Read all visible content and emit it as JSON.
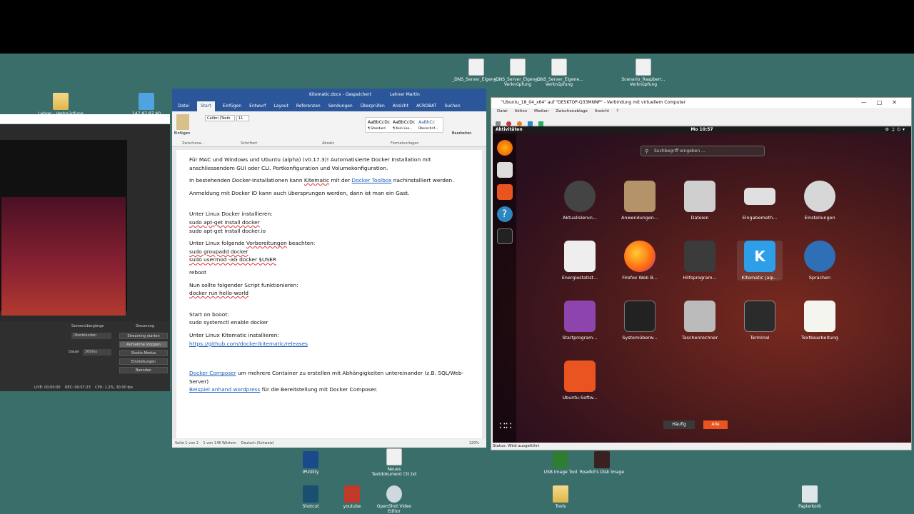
{
  "desktop": {
    "icons": [
      {
        "label": "_DNS_Server_Eigene...",
        "sub": ""
      },
      {
        "label": "_DNS_Server_Eigene...",
        "sub": "Verknüpfung"
      },
      {
        "label": "_DNS_Server_Eigene...",
        "sub": "Verknüpfung"
      },
      {
        "label": "Scenario_Raspberr...",
        "sub": "Verknüpfung"
      },
      {
        "label": "Lehrer - Verknüpfung",
        "sub": ""
      },
      {
        "label": "147.87.87.40",
        "sub": ""
      },
      {
        "label": "IPUtility",
        "sub": ""
      },
      {
        "label": "Neues",
        "sub": "Textdokument (3).txt"
      },
      {
        "label": "USB Image Tool",
        "sub": ""
      },
      {
        "label": "Roadkil's Disk Image",
        "sub": ""
      },
      {
        "label": "Shotcut",
        "sub": ""
      },
      {
        "label": "youtube",
        "sub": ""
      },
      {
        "label": "OpenShot Video",
        "sub": "Editor"
      },
      {
        "label": "Tools",
        "sub": ""
      },
      {
        "label": "Papierkorb",
        "sub": ""
      }
    ]
  },
  "obs": {
    "dock_headers": {
      "transitions": "Szenenübergänge",
      "controls": "Steuerung"
    },
    "transition_value": "Überblenden",
    "duration_label": "Dauer",
    "duration_value": "300ms",
    "buttons": [
      "Streaming starten",
      "Aufnahme stoppen",
      "Studio-Modus",
      "Einstellungen",
      "Beenden"
    ],
    "status": {
      "live": "LIVE: 00:00:00",
      "rec": "REC: 00:07:23",
      "cpu": "CPU: 1.2%, 30.00 fps"
    }
  },
  "word": {
    "title": "Kitematic.docx - Gespeichert",
    "user": "Lehner Martin",
    "tabs": [
      "Datei",
      "Start",
      "Einfügen",
      "Entwurf",
      "Layout",
      "Referenzen",
      "Sendungen",
      "Überprüfen",
      "Ansicht",
      "ACROBAT",
      "Suchen"
    ],
    "active_tab": "Start",
    "ribbon": {
      "font": "Calibri (Textk",
      "size": "11",
      "paste": "Einfügen",
      "styles": [
        "AaBbCcDc",
        "AaBbCcDc",
        "AaBbCc"
      ],
      "style_names": [
        "¶ Standard",
        "¶ Kein Lee...",
        "Überschrif..."
      ],
      "groups": [
        "Zwischena...",
        "Schriftart",
        "Absatz",
        "Formatvorlagen",
        "Bearbeiten"
      ]
    },
    "doc": {
      "p1": "Für MAC und Windows und Ubuntu (alpha) (v0.17.3)! Automatisierte Docker Installation mit anschliessendem GUI oder CLI. Portkonfiguration und Volumekonfiguration.",
      "p2a": "In bestehenden Docker-Installationen kann ",
      "p2b": "Kitematic",
      "p2c": " mit der ",
      "p2link": "Docker Toolbox",
      "p2d": " nachinstalliert werden.",
      "p3": "Anmeldung mit Docker ID kann auch übersprungen werden, dann ist man ein Gast.",
      "p4": "Unter Linux Docker installieren:",
      "c1": "sudo apt-get install docker",
      "c2": "sudo apt-get install docker.io",
      "p5a": "Unter Linux folgende ",
      "p5b": "Vorbereitungen",
      "p5c": " beachten:",
      "c3": "sudo groupadd docker",
      "c4": "sudo usermod -aG docker $USER",
      "p6": "reboot",
      "p7": "Nun sollte folgender Script funktionieren:",
      "c5": "docker run hello-world",
      "p8": "Start on booot:",
      "c6": "sudo systemctl enable docker",
      "p9": "Unter Linux Kitematic installieren:",
      "link1": "https://github.com/docker/kitematic/releases",
      "link2": "Docker Composer",
      "p10": " um mehrere Container zu erstellen mit Abhängigkeiten untereinander (z.B. SQL/Web-Server)",
      "link3": "Beispiel anhand wordpress",
      "p11": " für die Bereitstellung mit Docker Composer."
    },
    "status": {
      "page": "Seite 1 von 2",
      "words": "1 von 146 Wörtern",
      "lang": "Deutsch (Schweiz)",
      "zoom": "120%"
    }
  },
  "vm": {
    "title": "\"Ubuntu_18_04_x64\" auf \"DESKTOP-Q33MNNP\" - Verbindung mit virtuellem Computer",
    "menu": [
      "Datei",
      "Aktion",
      "Medien",
      "Zwischenablage",
      "Ansicht",
      "?"
    ],
    "status": "Status: Wird ausgeführt"
  },
  "ubuntu": {
    "activities": "Aktivitäten",
    "clock": "Mo 10:57",
    "search_placeholder": "Suchbegriff eingeben ...",
    "apps": [
      {
        "label": "Aktualisierun...",
        "icon": "software-updater-icon"
      },
      {
        "label": "Anwendungen...",
        "icon": "software-properties-icon"
      },
      {
        "label": "Dateien",
        "icon": "files-icon"
      },
      {
        "label": "Eingabemeth...",
        "icon": "keyboard-icon"
      },
      {
        "label": "Einstellungen",
        "icon": "settings-icon"
      },
      {
        "label": "Energiestatist...",
        "icon": "power-statistics-icon"
      },
      {
        "label": "Firefox Web B...",
        "icon": "firefox-icon"
      },
      {
        "label": "Hilfsprogram...",
        "icon": "utilities-icon"
      },
      {
        "label": "Kitematic (alp...",
        "icon": "kitematic-icon"
      },
      {
        "label": "Sprachen",
        "icon": "language-icon"
      },
      {
        "label": "Startprogram...",
        "icon": "startup-apps-icon"
      },
      {
        "label": "Systemüberw...",
        "icon": "system-monitor-icon"
      },
      {
        "label": "Taschenrechner",
        "icon": "calculator-icon"
      },
      {
        "label": "Terminal",
        "icon": "terminal-icon"
      },
      {
        "label": "Textbearbeitung",
        "icon": "text-editor-icon"
      },
      {
        "label": "Ubuntu-Softw...",
        "icon": "ubuntu-software-icon"
      }
    ],
    "frequent": "Häufig",
    "all": "Alle"
  }
}
